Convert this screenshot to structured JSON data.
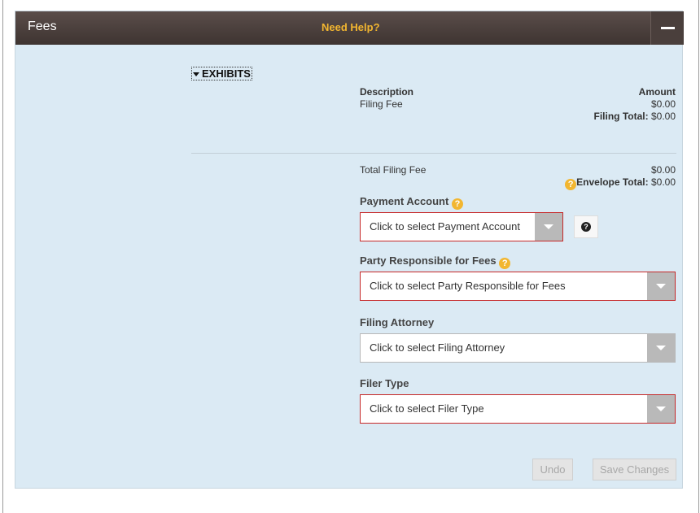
{
  "header": {
    "title": "Fees",
    "help_label": "Need Help?"
  },
  "exhibits": {
    "label": "EXHIBITS"
  },
  "fees": {
    "description_header": "Description",
    "amount_header": "Amount",
    "items": [
      {
        "description": "Filing Fee",
        "amount": "$0.00"
      }
    ],
    "filing_total_label": "Filing Total:",
    "filing_total_value": "$0.00"
  },
  "totals": {
    "total_filing_fee_label": "Total Filing Fee",
    "total_filing_fee_value": "$0.00",
    "envelope_total_label": "Envelope Total:",
    "envelope_total_value": "$0.00",
    "help_glyph": "?"
  },
  "form": {
    "payment_account": {
      "label": "Payment Account",
      "placeholder": "Click to select Payment Account",
      "info_glyph": "?"
    },
    "party_responsible": {
      "label": "Party Responsible for Fees",
      "placeholder": "Click to select Party Responsible for Fees"
    },
    "filing_attorney": {
      "label": "Filing Attorney",
      "placeholder": "Click to select Filing Attorney"
    },
    "filer_type": {
      "label": "Filer Type",
      "placeholder": "Click to select Filer Type"
    }
  },
  "actions": {
    "undo_label": "Undo",
    "save_label": "Save Changes"
  },
  "colors": {
    "panel_bg": "#dbeaf4",
    "header_bg": "#4a3f3c",
    "help_accent": "#f2b630",
    "error_border": "#c62828"
  }
}
